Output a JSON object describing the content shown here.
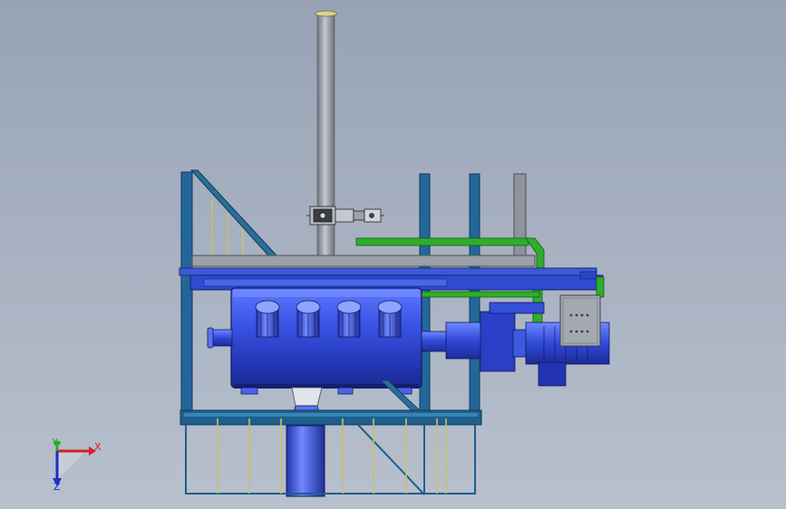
{
  "triad": {
    "x_label": "X",
    "y_label": "Y",
    "z_label": "Z"
  },
  "colors": {
    "bg_top": "#98a4b6",
    "bg_bottom": "#b6bfcc",
    "frame_blue": "#1f5f8c",
    "frame_dark": "#0e3a5c",
    "rail_yellow": "#c9bf6a",
    "tank_blue": "#2a44cc",
    "tank_light": "#7e98ff",
    "pipe_green": "#2fa12a",
    "steel_grey": "#8e939c",
    "x_axis": "#d42020",
    "y_axis": "#20b020",
    "z_axis": "#1c2cc8"
  }
}
